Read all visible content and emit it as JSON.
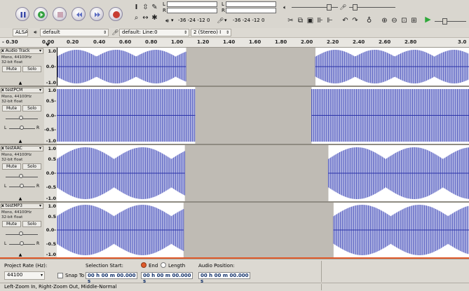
{
  "toolbar": {
    "buttons": [
      "pause",
      "play",
      "stop",
      "skip-start",
      "skip-end",
      "record"
    ],
    "meter_scale_rec": "-36 -24 -12 0",
    "meter_scale_play": "-36 -24 -12 0",
    "meter_l": "L",
    "meter_r": "R"
  },
  "devices": {
    "host": "ALSA",
    "output": "default",
    "input": "default: Line:0",
    "channels": "2 (Stereo) I"
  },
  "ruler": {
    "labels": [
      "- 0.30",
      "0.00",
      "0.20",
      "0.40",
      "0.60",
      "0.80",
      "1.00",
      "1.20",
      "1.40",
      "1.60",
      "1.80",
      "2.00",
      "2.20",
      "2.40",
      "2.60",
      "2.80",
      "3.0"
    ]
  },
  "tracks": [
    {
      "name": "Audio Track",
      "info1": "Mono, 44100Hz",
      "info2": "32-bit float",
      "mute": "Mute",
      "solo": "Solo",
      "scale": [
        "1.0",
        "0.0-",
        "-1.0"
      ],
      "lr": false
    },
    {
      "name": "testPCM",
      "info1": "Mono, 44100Hz",
      "info2": "32-bit float",
      "mute": "Mute",
      "solo": "Solo",
      "scale": [
        "1.0",
        "0.5-",
        "0.0-",
        "-0.5-",
        "-1.0"
      ],
      "lr": true,
      "left": "L",
      "right": "R"
    },
    {
      "name": "testAAC",
      "info1": "Mono, 44100Hz",
      "info2": "32-bit float",
      "mute": "Mute",
      "solo": "Solo",
      "scale": [
        "1.0",
        "0.5",
        "0.0-",
        "-0.5",
        "-1.0"
      ],
      "lr": true,
      "left": "L",
      "right": "R"
    },
    {
      "name": "testMP3",
      "info1": "Mono, 44100Hz",
      "info2": "32-bit float",
      "mute": "Mute",
      "solo": "Solo",
      "scale": [
        "1.0",
        "0.5",
        "0.0-",
        "-0.5",
        "-1.0"
      ],
      "lr": true,
      "left": "L",
      "right": "R"
    }
  ],
  "selection": {
    "project_rate_label": "Project Rate (Hz):",
    "project_rate": "44100",
    "snap_label": "Snap To",
    "selection_start_label": "Selection Start:",
    "end_label": "End",
    "length_label": "Length",
    "audio_position_label": "Audio Position:",
    "start_time": "00 h 00 m 00.000 s",
    "end_time": "00 h 00 m 00.000 s",
    "audio_pos": "00 h 00 m 00.000 s"
  },
  "status": {
    "text": "Left-Zoom In, Right-Zoom Out, Middle-Normal"
  }
}
